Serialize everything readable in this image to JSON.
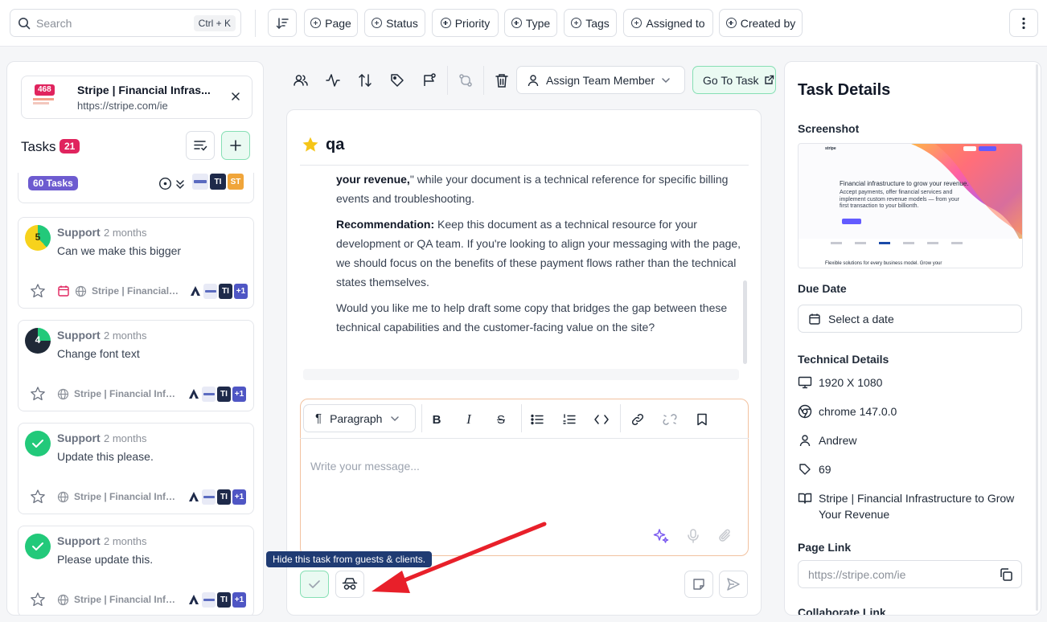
{
  "search": {
    "placeholder": "Search",
    "shortcut": "Ctrl + K"
  },
  "filters": [
    "Page",
    "Status",
    "Priority",
    "Type",
    "Tags",
    "Assigned to",
    "Created by"
  ],
  "site": {
    "badge": "468",
    "title": "Stripe | Financial Infras...",
    "url": "https://stripe.com/ie"
  },
  "tasks_panel": {
    "title": "Tasks",
    "count": "21"
  },
  "group": {
    "badge": "60 Tasks",
    "avatars": [
      "TI",
      "ST"
    ]
  },
  "tasks": [
    {
      "status_num": "5",
      "category": "Support",
      "time": "2 months",
      "title": "Can we make this bigger",
      "site": "Stripe | Financial Infi",
      "avatars": [
        "TI"
      ],
      "more": "+1"
    },
    {
      "status_num": "4",
      "category": "Support",
      "time": "2 months",
      "title": "Change font text",
      "site": "Stripe | Financial Infra...",
      "avatars": [
        "TI"
      ],
      "more": "+1"
    },
    {
      "status_num": "",
      "category": "Support",
      "time": "2 months",
      "title": "Update this please.",
      "site": "Stripe | Financial Infra...",
      "avatars": [
        "TI"
      ],
      "more": "+1"
    },
    {
      "status_num": "",
      "category": "Support",
      "time": "2 months",
      "title": "Please update this.",
      "site": "Stripe | Financial Infra...",
      "avatars": [
        "TI"
      ],
      "more": "+1"
    }
  ],
  "mid_toolbar": {
    "assign_label": "Assign Team Member",
    "goto_label": "Go To Task"
  },
  "chat": {
    "title": "qa",
    "p1_bold": "your revenue,",
    "p1_rest": "\" while your document is a technical reference for specific billing events and troubleshooting.",
    "p2_bold": "Recommendation:",
    "p2_rest": " Keep this document as a technical resource for your development or QA team. If you're looking to align your messaging with the page, we should focus on the benefits of these payment flows rather than the technical states themselves.",
    "p3": "Would you like me to help draft some copy that bridges the gap between these technical capabilities and the customer-facing value on the site?"
  },
  "editor": {
    "block_type": "Paragraph",
    "placeholder": "Write your message..."
  },
  "tooltip": "Hide this task from guests & clients.",
  "details": {
    "title": "Task Details",
    "screenshot_label": "Screenshot",
    "shot_headline": "Financial infrastructure to grow your revenue.",
    "shot_sub": "Accept payments, offer financial services and implement custom revenue models — from your first transaction to your billionth.",
    "shot_footer": "Flexible solutions for every business model. Grow your",
    "shot_brand": "stripe",
    "due_label": "Due Date",
    "due_value": "Select a date",
    "tech_label": "Technical Details",
    "resolution": "1920 X 1080",
    "browser": "chrome 147.0.0",
    "user": "Andrew",
    "number": "69",
    "page_title": "Stripe | Financial Infrastructure to Grow Your Revenue",
    "link_label": "Page Link",
    "link_value": "https://stripe.com/ie",
    "collab_label": "Collaborate Link"
  },
  "colors": {
    "accent_green": "#22c97a",
    "badge_red": "#e0245e",
    "badge_purple": "#6d5bd0",
    "tooltip_navy": "#1f3b73",
    "arrow_red": "#e8202a"
  }
}
